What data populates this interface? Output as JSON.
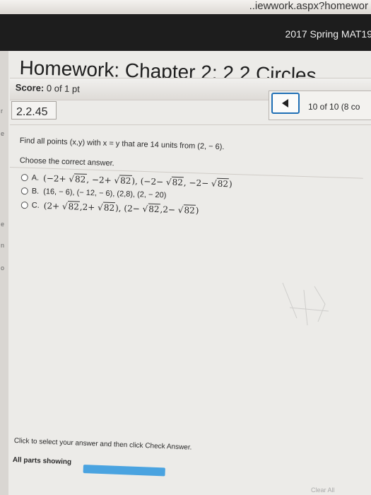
{
  "browser": {
    "url_text": "..iewwork.aspx?homewor"
  },
  "header": {
    "course": "2017 Spring MAT19"
  },
  "homework": {
    "title": "Homework: Chapter 2: 2.2 Circles",
    "score_label": "Score:",
    "score_value": "0 of 1 pt",
    "question_number": "2.2.45",
    "nav_text": "10 of 10 (8 co"
  },
  "question": {
    "prompt": "Find all points (x,y) with x = y that are 14 units from (2, − 6).",
    "instruction": "Choose the correct answer.",
    "options": [
      {
        "label": "A.",
        "parts": [
          "(−2+ ",
          "√",
          "82",
          ", −2+ ",
          "√",
          "82",
          "), (−2− ",
          "√",
          "82",
          ", −2− ",
          "√",
          "82",
          ")"
        ]
      },
      {
        "label": "B.",
        "text": "(16, − 6), (− 12, − 6), (2,8), (2, − 20)"
      },
      {
        "label": "C.",
        "parts": [
          "(2+ ",
          "√",
          "82",
          ",2+ ",
          "√",
          "82",
          "), (2− ",
          "√",
          "82",
          ",2− ",
          "√",
          "82",
          ")"
        ]
      }
    ]
  },
  "footer": {
    "hint": "Click to select your answer and then click Check Answer.",
    "parts": "All parts showing",
    "clear": "Clear All"
  },
  "colors": {
    "accent": "#1f6fb5",
    "progress": "#4aa3e0",
    "topbar": "#1d1d1d"
  }
}
